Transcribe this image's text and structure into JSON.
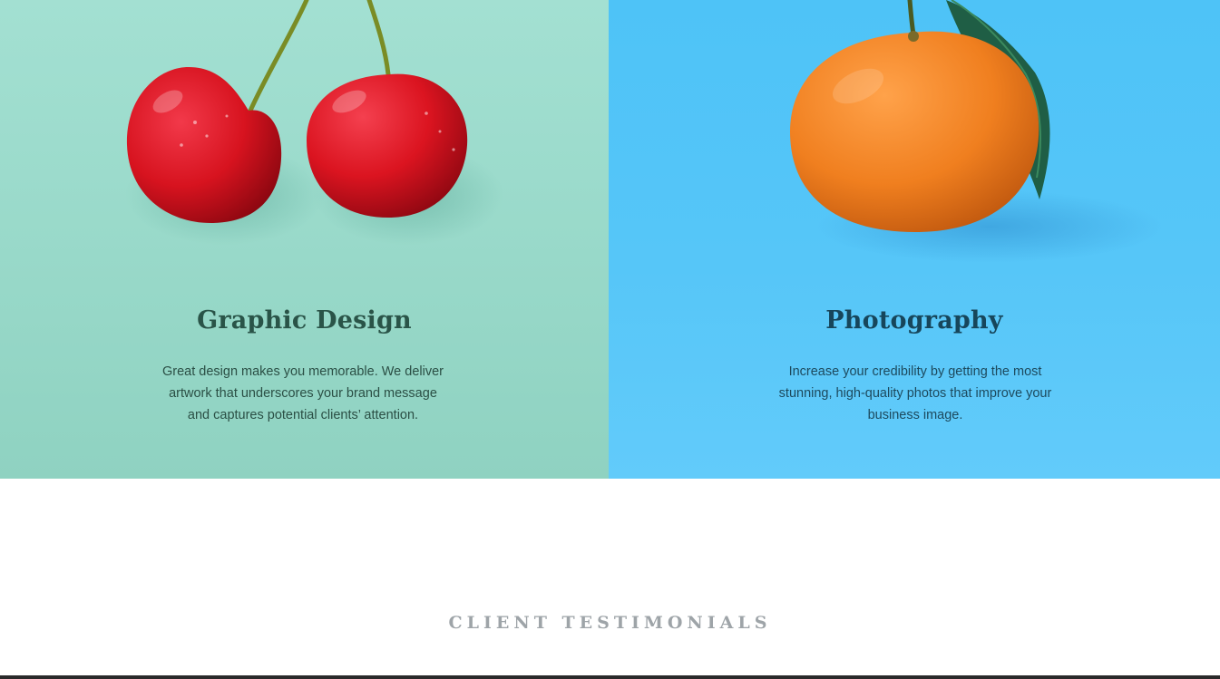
{
  "services": [
    {
      "title": "Graphic Design",
      "description": "Great design makes you memorable. We deliver artwork that underscores your brand message and captures potential clients’ attention.",
      "image": "cherries-image",
      "background": "#9adbcb",
      "title_color": "#2a5448"
    },
    {
      "title": "Photography",
      "description": "Increase your credibility by getting the most stunning, high-quality photos that improve your business image.",
      "image": "orange-image",
      "background": "#52c5f8",
      "title_color": "#17465b"
    }
  ],
  "testimonials": {
    "heading": "CLIENT TESTIMONIALS",
    "heading_color": "#9ea4a8"
  }
}
